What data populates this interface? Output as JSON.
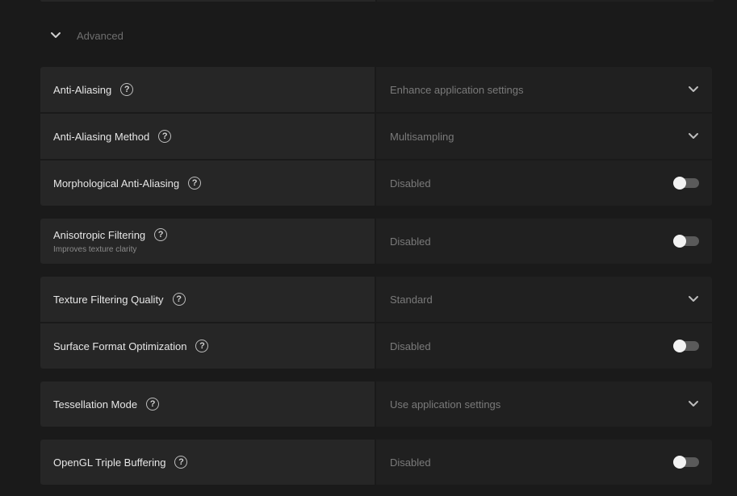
{
  "section": {
    "title": "Advanced",
    "expanded": true
  },
  "settings": [
    {
      "label": "Anti-Aliasing",
      "value": "Enhance application settings",
      "control": "dropdown"
    },
    {
      "label": "Anti-Aliasing Method",
      "value": "Multisampling",
      "control": "dropdown"
    },
    {
      "label": "Morphological Anti-Aliasing",
      "value": "Disabled",
      "control": "toggle",
      "on": false
    },
    {
      "label": "Anisotropic Filtering",
      "sublabel": "Improves texture clarity",
      "value": "Disabled",
      "control": "toggle",
      "on": false
    },
    {
      "label": "Texture Filtering Quality",
      "value": "Standard",
      "control": "dropdown"
    },
    {
      "label": "Surface Format Optimization",
      "value": "Disabled",
      "control": "toggle",
      "on": false
    },
    {
      "label": "Tessellation Mode",
      "value": "Use application settings",
      "control": "dropdown"
    },
    {
      "label": "OpenGL Triple Buffering",
      "value": "Disabled",
      "control": "toggle",
      "on": false
    }
  ],
  "icons": {
    "help": "question-circle-icon",
    "expand": "chevron-down-icon"
  },
  "colors": {
    "background": "#1a1a1a",
    "label_cell": "#262626",
    "value_cell": "#202020",
    "toggle_track_off": "#5a5a5a",
    "toggle_knob": "#f2f2f2"
  }
}
